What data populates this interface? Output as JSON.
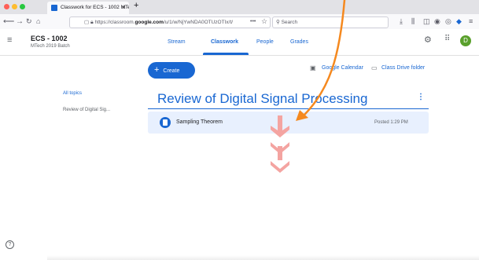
{
  "browser": {
    "tab_title": "Classwork for ECS - 1002 MTec",
    "tab_close": "×",
    "new_tab": "+",
    "url": "https://classroom.google.com/u/1/w/NjYwNDA0OTUzOTIx/t/",
    "url_domain_part": "google.com",
    "url_prefix": "https://classroom.",
    "url_suffix": "/u/1/w/NjYwNDA0OTUzOTIx/t/",
    "search_placeholder": "Search",
    "more_dots": "•••"
  },
  "course": {
    "name": "ECS - 1002",
    "subtitle": "MTech 2019 Batch",
    "avatar_letter": "D"
  },
  "nav_tabs": [
    "Stream",
    "Classwork",
    "People",
    "Grades"
  ],
  "actions": {
    "create": "Create",
    "calendar": "Google Calendar",
    "drive": "Class Drive folder"
  },
  "sidebar": {
    "items": [
      "All topics",
      "Review of Digital Sig..."
    ]
  },
  "topic": {
    "title": "Review of Digital Signal Processing",
    "menu": "⋮",
    "assignment": "Sampling Theorem",
    "posted": "Posted 1:29 PM"
  },
  "help": "?",
  "colors": {
    "accent": "#1967d2",
    "annotation_arrow": "#f5891f",
    "annotation_chevrons": "#f4a4a1"
  }
}
